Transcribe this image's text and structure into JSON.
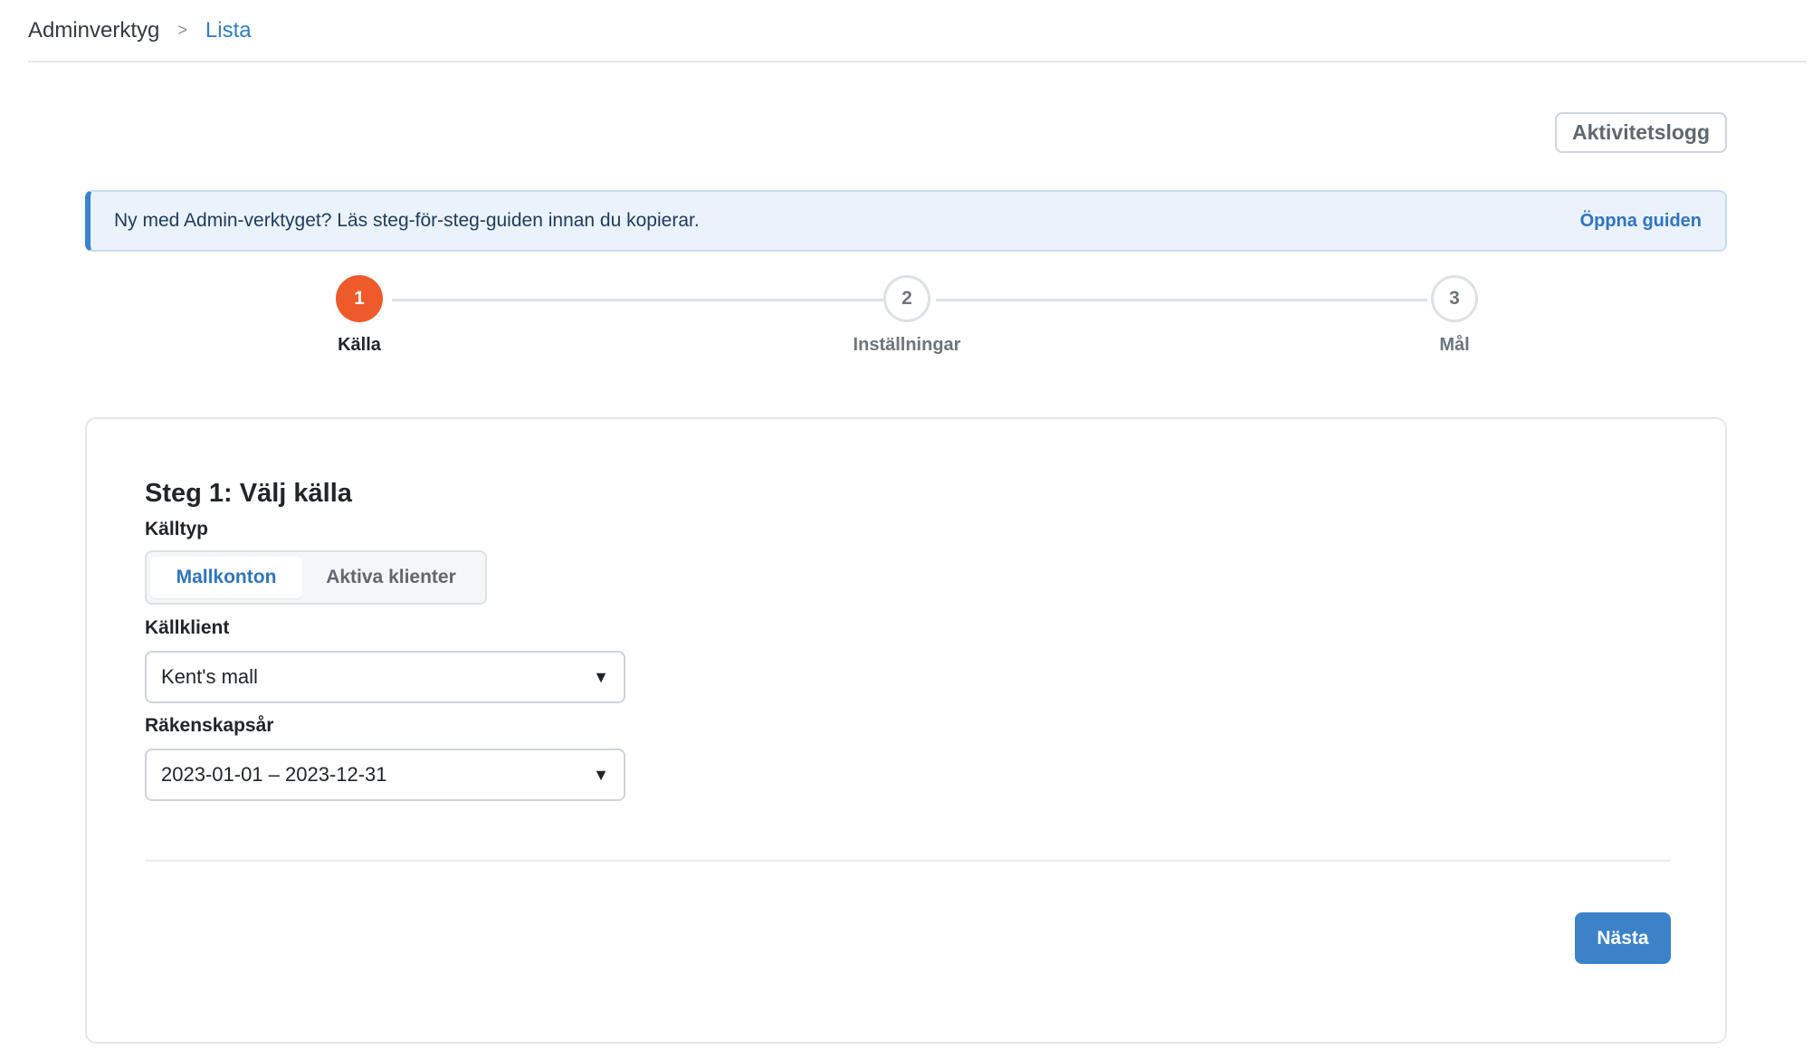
{
  "breadcrumb": {
    "root": "Adminverktyg",
    "separator": ">",
    "current": "Lista"
  },
  "header": {
    "activity_log_label": "Aktivitetslogg"
  },
  "guide_banner": {
    "text": "Ny med Admin-verktyget? Läs steg-för-steg-guiden innan du kopierar.",
    "link_label": "Öppna guiden",
    "accent_color": "#3b82d0"
  },
  "stepper": {
    "active_color": "#ee5a2a",
    "steps": [
      {
        "number": "1",
        "label": "Källa",
        "state": "active"
      },
      {
        "number": "2",
        "label": "Inställningar",
        "state": "inactive"
      },
      {
        "number": "3",
        "label": "Mål",
        "state": "inactive"
      }
    ]
  },
  "form": {
    "title": "Steg 1: Välj källa",
    "source_type_label": "Källtyp",
    "source_type_options": [
      "Mallkonton",
      "Aktiva klienter"
    ],
    "source_type_selected": "Mallkonton",
    "source_client_label": "Källklient",
    "source_client_value": "Kent's mall",
    "fiscal_year_label": "Räkenskapsår",
    "fiscal_year_value": "2023-01-01 – 2023-12-31",
    "caret_icon": "▼",
    "next_label": "Nästa",
    "primary_color": "#3b82c8"
  }
}
